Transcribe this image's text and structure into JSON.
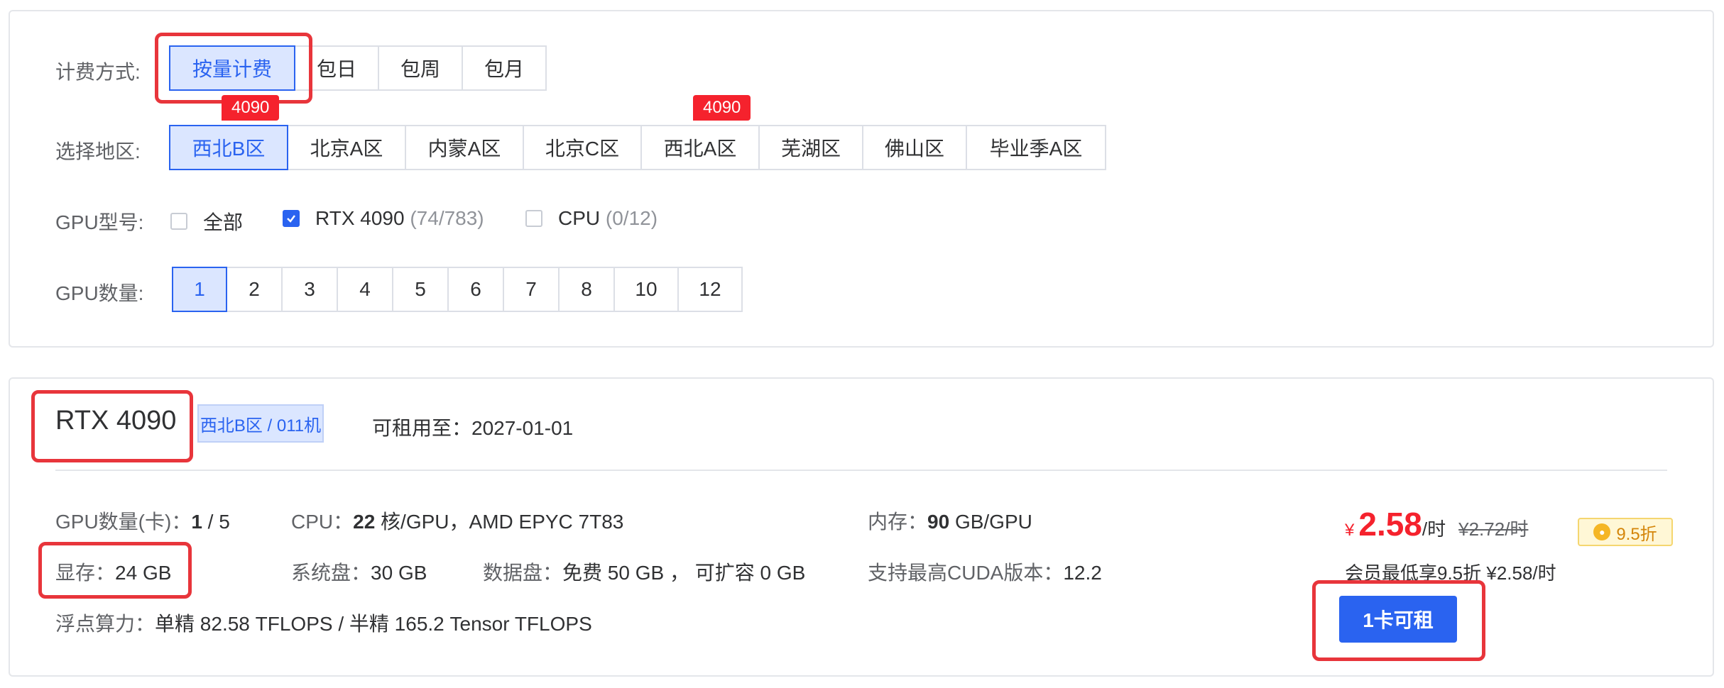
{
  "filters": {
    "billing": {
      "label": "计费方式:",
      "options": [
        "按量计费",
        "包日",
        "包周",
        "包月"
      ],
      "selected": "按量计费"
    },
    "region": {
      "label": "选择地区:",
      "options": [
        "西北B区",
        "北京A区",
        "内蒙A区",
        "北京C区",
        "西北A区",
        "芜湖区",
        "佛山区",
        "毕业季A区"
      ],
      "selected": "西北B区",
      "badges": [
        "4090",
        "4090"
      ]
    },
    "gpu_model": {
      "label": "GPU型号:",
      "options": [
        {
          "name": "全部",
          "count": "",
          "checked": false
        },
        {
          "name": "RTX 4090",
          "count": "(74/783)",
          "checked": true
        },
        {
          "name": "CPU",
          "count": "(0/12)",
          "checked": false
        }
      ]
    },
    "gpu_count": {
      "label": "GPU数量:",
      "options": [
        "1",
        "2",
        "3",
        "4",
        "5",
        "6",
        "7",
        "8",
        "10",
        "12"
      ],
      "selected": "1"
    }
  },
  "machine": {
    "gpu_name": "RTX 4090",
    "region_tag": "西北B区 / 011机",
    "available_until": "可租用至：2027-01-01",
    "specs": {
      "gpu_count_label": "GPU数量(卡)：",
      "gpu_count_value": "1",
      "gpu_count_total": " / 5",
      "cpu_label": "CPU：",
      "cpu_value": "22",
      "cpu_rest": " 核/GPU，AMD EPYC 7T83",
      "mem_label": "内存：",
      "mem_value": "90",
      "mem_rest": " GB/GPU",
      "vram_label": "显存：",
      "vram_value": "24 GB",
      "sys_disk_label": "系统盘：",
      "sys_disk_value": "30 GB",
      "data_disk_label": "数据盘：",
      "data_disk_value": "免费 50 GB ， 可扩容 0 GB",
      "cuda_label": "支持最高CUDA版本：",
      "cuda_value": "12.2",
      "flops_label": "浮点算力：",
      "flops_value": "单精 82.58 TFLOPS / 半精 165.2 Tensor TFLOPS"
    },
    "price": {
      "currency": "¥",
      "value": "2.58",
      "unit": "/时",
      "original": "¥2.72/时",
      "discount": "9.5折",
      "member_note": "会员最低享9.5折 ¥2.58/时"
    },
    "rent_button": "1卡可租"
  },
  "colors": {
    "accent": "#2a63f0",
    "accent_light": "#dbe6ff",
    "price_red": "#f5222d",
    "highlight_frame": "#e8353b"
  }
}
